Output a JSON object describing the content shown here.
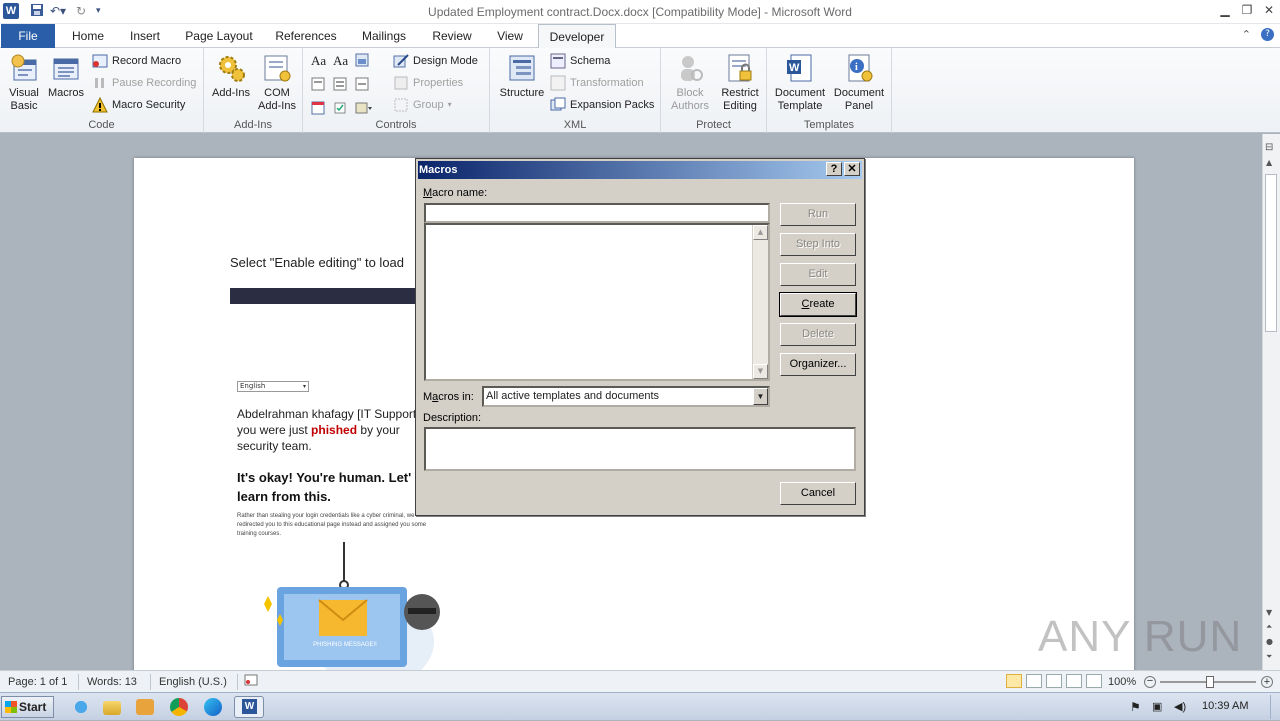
{
  "titlebar": {
    "title": "Updated Employment contract.Docx.docx [Compatibility Mode] - Microsoft Word",
    "app_icon": "W"
  },
  "tabs": {
    "file": "File",
    "home": "Home",
    "insert": "Insert",
    "page_layout": "Page Layout",
    "references": "References",
    "mailings": "Mailings",
    "review": "Review",
    "view": "View",
    "developer": "Developer"
  },
  "ribbon": {
    "code": {
      "label": "Code",
      "visual_basic": "Visual\nBasic",
      "macros": "Macros",
      "record_macro": "Record Macro",
      "pause_recording": "Pause Recording",
      "macro_security": "Macro Security"
    },
    "addins": {
      "label": "Add-Ins",
      "addins": "Add-Ins",
      "com_addins": "COM\nAdd-Ins"
    },
    "controls": {
      "label": "Controls",
      "design_mode": "Design Mode",
      "properties": "Properties",
      "group": "Group"
    },
    "xml": {
      "label": "XML",
      "structure": "Structure",
      "schema": "Schema",
      "transformation": "Transformation",
      "expansion_packs": "Expansion Packs"
    },
    "protect": {
      "label": "Protect",
      "block_authors": "Block\nAuthors",
      "restrict_editing": "Restrict\nEditing"
    },
    "templates": {
      "label": "Templates",
      "document_template": "Document\nTemplate",
      "document_panel": "Document\nPanel"
    }
  },
  "document": {
    "enable_text": "Select \"Enable editing\" to load",
    "language": "English",
    "line1": "Abdelrahman khafagy [IT Support_",
    "line2_pre": "you were just ",
    "line2_em": "phished",
    "line2_post": " by your",
    "line3": "security team.",
    "heading1": "It's okay! You're human. Let'",
    "heading2": "learn from this.",
    "small_text": "Rather than stealing your login credentials like a cyber criminal, we have redirected you to this educational page instead and assigned you some training courses.",
    "envelope_caption": "PHISHING MESSAGE!!"
  },
  "dialog": {
    "title": "Macros",
    "help": "?",
    "close": "✕",
    "macro_name_label": "Macro name:",
    "macro_name_value": "",
    "macros_in_label": "Macros in:",
    "macros_in_value": "All active templates and documents",
    "description_label": "Description:",
    "buttons": {
      "run": "Run",
      "step_into": "Step Into",
      "edit": "Edit",
      "create": "Create",
      "delete": "Delete",
      "organizer": "Organizer...",
      "cancel": "Cancel"
    }
  },
  "status": {
    "page": "Page: 1 of 1",
    "words": "Words: 13",
    "language": "English (U.S.)",
    "zoom": "100%"
  },
  "taskbar": {
    "start": "Start",
    "time": "10:39 AM"
  },
  "watermark": "ANY RUN",
  "colors": {
    "file_tab": "#2a5ea8",
    "dialog_title": "#0a246a",
    "phished": "#c00000",
    "dark_bar": "#2b2d42"
  }
}
